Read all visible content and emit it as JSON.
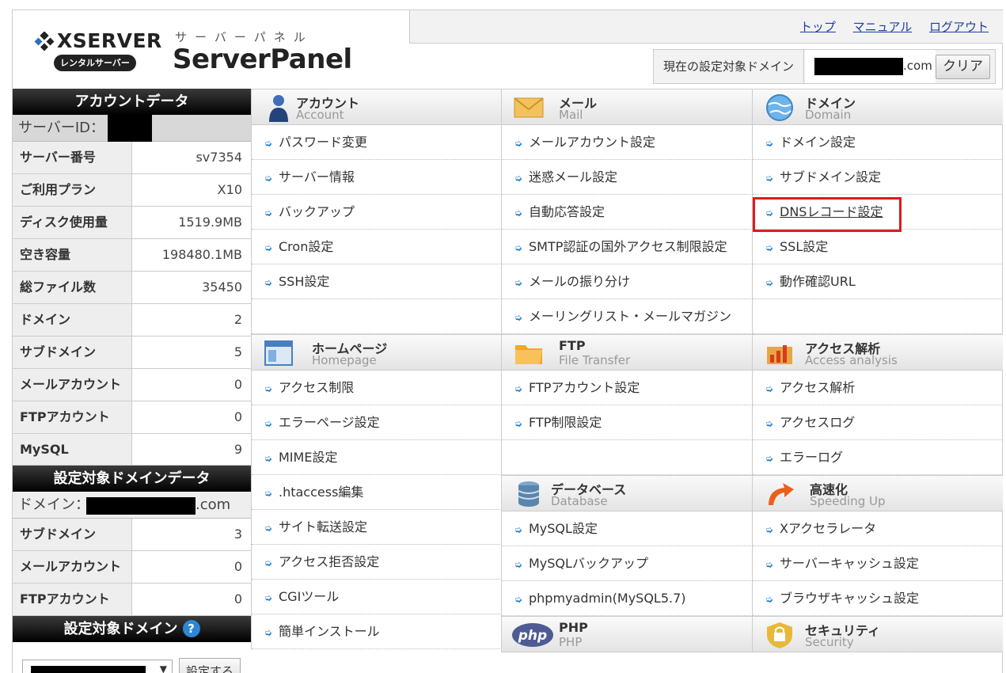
{
  "header": {
    "brand": "XSERVER",
    "brand_badge": "レンタルサーバー",
    "panel_kana": "サーバーパネル",
    "panel_title": "ServerPanel",
    "links": [
      "トップ",
      "マニュアル",
      "ログアウト"
    ],
    "domain_label": "現在の設定対象ドメイン",
    "domain_tld": ".com",
    "clear_button": "クリア"
  },
  "account": {
    "heading": "アカウントデータ",
    "server_id_label": "サーバーID：",
    "rows": [
      {
        "label": "サーバー番号",
        "value": "sv7354"
      },
      {
        "label": "ご利用プラン",
        "value": "X10"
      },
      {
        "label": "ディスク使用量",
        "value": "1519.9MB"
      },
      {
        "label": "空き容量",
        "value": "198480.1MB"
      },
      {
        "label": "総ファイル数",
        "value": "35450"
      },
      {
        "label": "ドメイン",
        "value": "2"
      },
      {
        "label": "サブドメイン",
        "value": "5"
      },
      {
        "label": "メールアカウント",
        "value": "0"
      },
      {
        "label": "FTPアカウント",
        "value": "0"
      },
      {
        "label": "MySQL",
        "value": "9"
      }
    ]
  },
  "domain_data": {
    "heading": "設定対象ドメインデータ",
    "domain_label": "ドメイン：",
    "domain_tld": ".com",
    "rows": [
      {
        "label": "サブドメイン",
        "value": "3"
      },
      {
        "label": "メールアカウント",
        "value": "0"
      },
      {
        "label": "FTPアカウント",
        "value": "0"
      }
    ]
  },
  "domain_select": {
    "heading": "設定対象ドメイン",
    "help": "?",
    "button": "設定する"
  },
  "sections": {
    "account": {
      "jp": "アカウント",
      "en": "Account",
      "items": [
        "パスワード変更",
        "サーバー情報",
        "バックアップ",
        "Cron設定",
        "SSH設定"
      ]
    },
    "mail": {
      "jp": "メール",
      "en": "Mail",
      "items": [
        "メールアカウント設定",
        "迷惑メール設定",
        "自動応答設定",
        "SMTP認証の国外アクセス制限設定",
        "メールの振り分け",
        "メーリングリスト・メールマガジン"
      ]
    },
    "domain": {
      "jp": "ドメイン",
      "en": "Domain",
      "items": [
        "ドメイン設定",
        "サブドメイン設定",
        "DNSレコード設定",
        "SSL設定",
        "動作確認URL"
      ]
    },
    "homepage": {
      "jp": "ホームページ",
      "en": "Homepage",
      "items": [
        "アクセス制限",
        "エラーページ設定",
        "MIME設定",
        ".htaccess編集",
        "サイト転送設定",
        "アクセス拒否設定",
        "CGIツール",
        "簡単インストール"
      ]
    },
    "ftp": {
      "jp": "FTP",
      "en": "File Transfer",
      "items": [
        "FTPアカウント設定",
        "FTP制限設定"
      ]
    },
    "access": {
      "jp": "アクセス解析",
      "en": "Access analysis",
      "items": [
        "アクセス解析",
        "アクセスログ",
        "エラーログ"
      ]
    },
    "database": {
      "jp": "データベース",
      "en": "Database",
      "items": [
        "MySQL設定",
        "MySQLバックアップ",
        "phpmyadmin(MySQL5.7)"
      ]
    },
    "speed": {
      "jp": "高速化",
      "en": "Speeding Up",
      "items": [
        "Xアクセラレータ",
        "サーバーキャッシュ設定",
        "ブラウザキャッシュ設定"
      ]
    },
    "php": {
      "jp": "PHP",
      "en": "PHP"
    },
    "security": {
      "jp": "セキュリティ",
      "en": "Security"
    }
  },
  "colors": {
    "highlight": "#e01a1a",
    "link": "#1a3ea0",
    "arrow": "#1a7acb"
  }
}
